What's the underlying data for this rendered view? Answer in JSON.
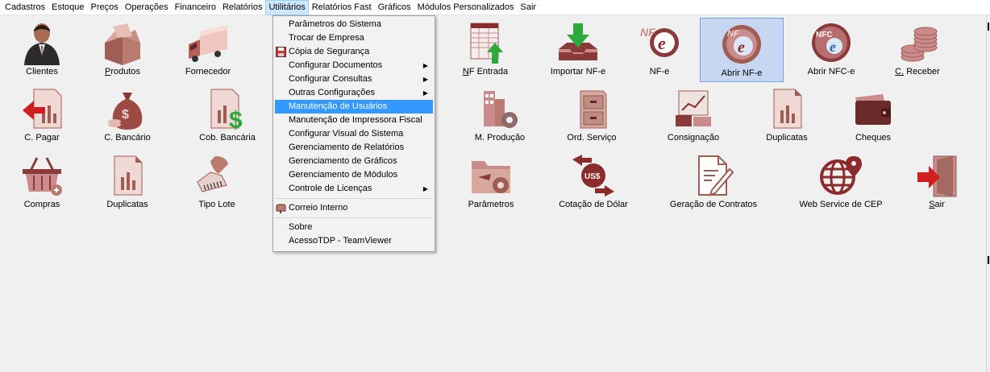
{
  "menubar": {
    "items": [
      "Cadastros",
      "Estoque",
      "Preços",
      "Operações",
      "Financeiro",
      "Relatórios",
      "Utilitários",
      "Relatórios Fast",
      "Gráficos",
      "Módulos Personalizados",
      "Sair"
    ],
    "active": "Utilitários"
  },
  "dropdown": {
    "items": [
      {
        "label": "Parâmetros do Sistema"
      },
      {
        "label": "Trocar de Empresa"
      },
      {
        "label": "Cópia de Segurança",
        "icon": "floppy-disk-icon"
      },
      {
        "label": "Configurar Documentos",
        "submenu": true
      },
      {
        "label": "Configurar Consultas",
        "submenu": true
      },
      {
        "label": "Outras Configurações",
        "submenu": true
      },
      {
        "label": "Manutenção de Usuários",
        "highlighted": true
      },
      {
        "label": "Manutenção de Impressora Fiscal"
      },
      {
        "label": "Configurar Visual do Sistema"
      },
      {
        "label": "Gerenciamento de Relatórios"
      },
      {
        "label": "Gerenciamento de Gráficos"
      },
      {
        "label": "Gerenciamento de Módulos"
      },
      {
        "label": "Controle de Licenças",
        "submenu": true
      },
      {
        "separator": true
      },
      {
        "label": "Correio Interno",
        "icon": "mailbox-icon"
      },
      {
        "separator": true
      },
      {
        "label": "Sobre"
      },
      {
        "label": "AcessoTDP - TeamViewer"
      }
    ]
  },
  "tiles": {
    "clientes": "Clientes",
    "produtos": "Produtos",
    "fornecedor": "Fornecedor",
    "nf_entrada": "NF Entrada",
    "importar_nfe": "Importar NF-e",
    "nfe": "NF-e",
    "abrir_nfe": "Abrir NF-e",
    "abrir_nfce": "Abrir NFC-e",
    "c_receber": "C. Receber",
    "c_pagar": "C. Pagar",
    "c_bancario": "C. Bancário",
    "cob_bancaria": "Cob. Bancária",
    "m_producao": "M. Produção",
    "ord_servico": "Ord. Serviço",
    "consignacao": "Consignação",
    "duplicatas_top": "Duplicatas",
    "cheques": "Cheques",
    "compras": "Compras",
    "duplicatas": "Duplicatas",
    "tipo_lote": "Tipo Lote",
    "parametros": "Parâmetros",
    "cotacao_dolar": "Cotação de Dólar",
    "geracao_contratos": "Geração de Contratos",
    "web_service_cep": "Web Service de CEP",
    "sair": "Sair"
  },
  "icon_texts": {
    "nfe_logo": "NF",
    "nfce_logo": "NFC",
    "us_dollar": "US$"
  },
  "colors": {
    "icon_maroon": "#8b2b2b",
    "icon_pink": "#c98b8b",
    "selection_bg": "#c7d7f2",
    "menu_highlight": "#3399ff"
  }
}
